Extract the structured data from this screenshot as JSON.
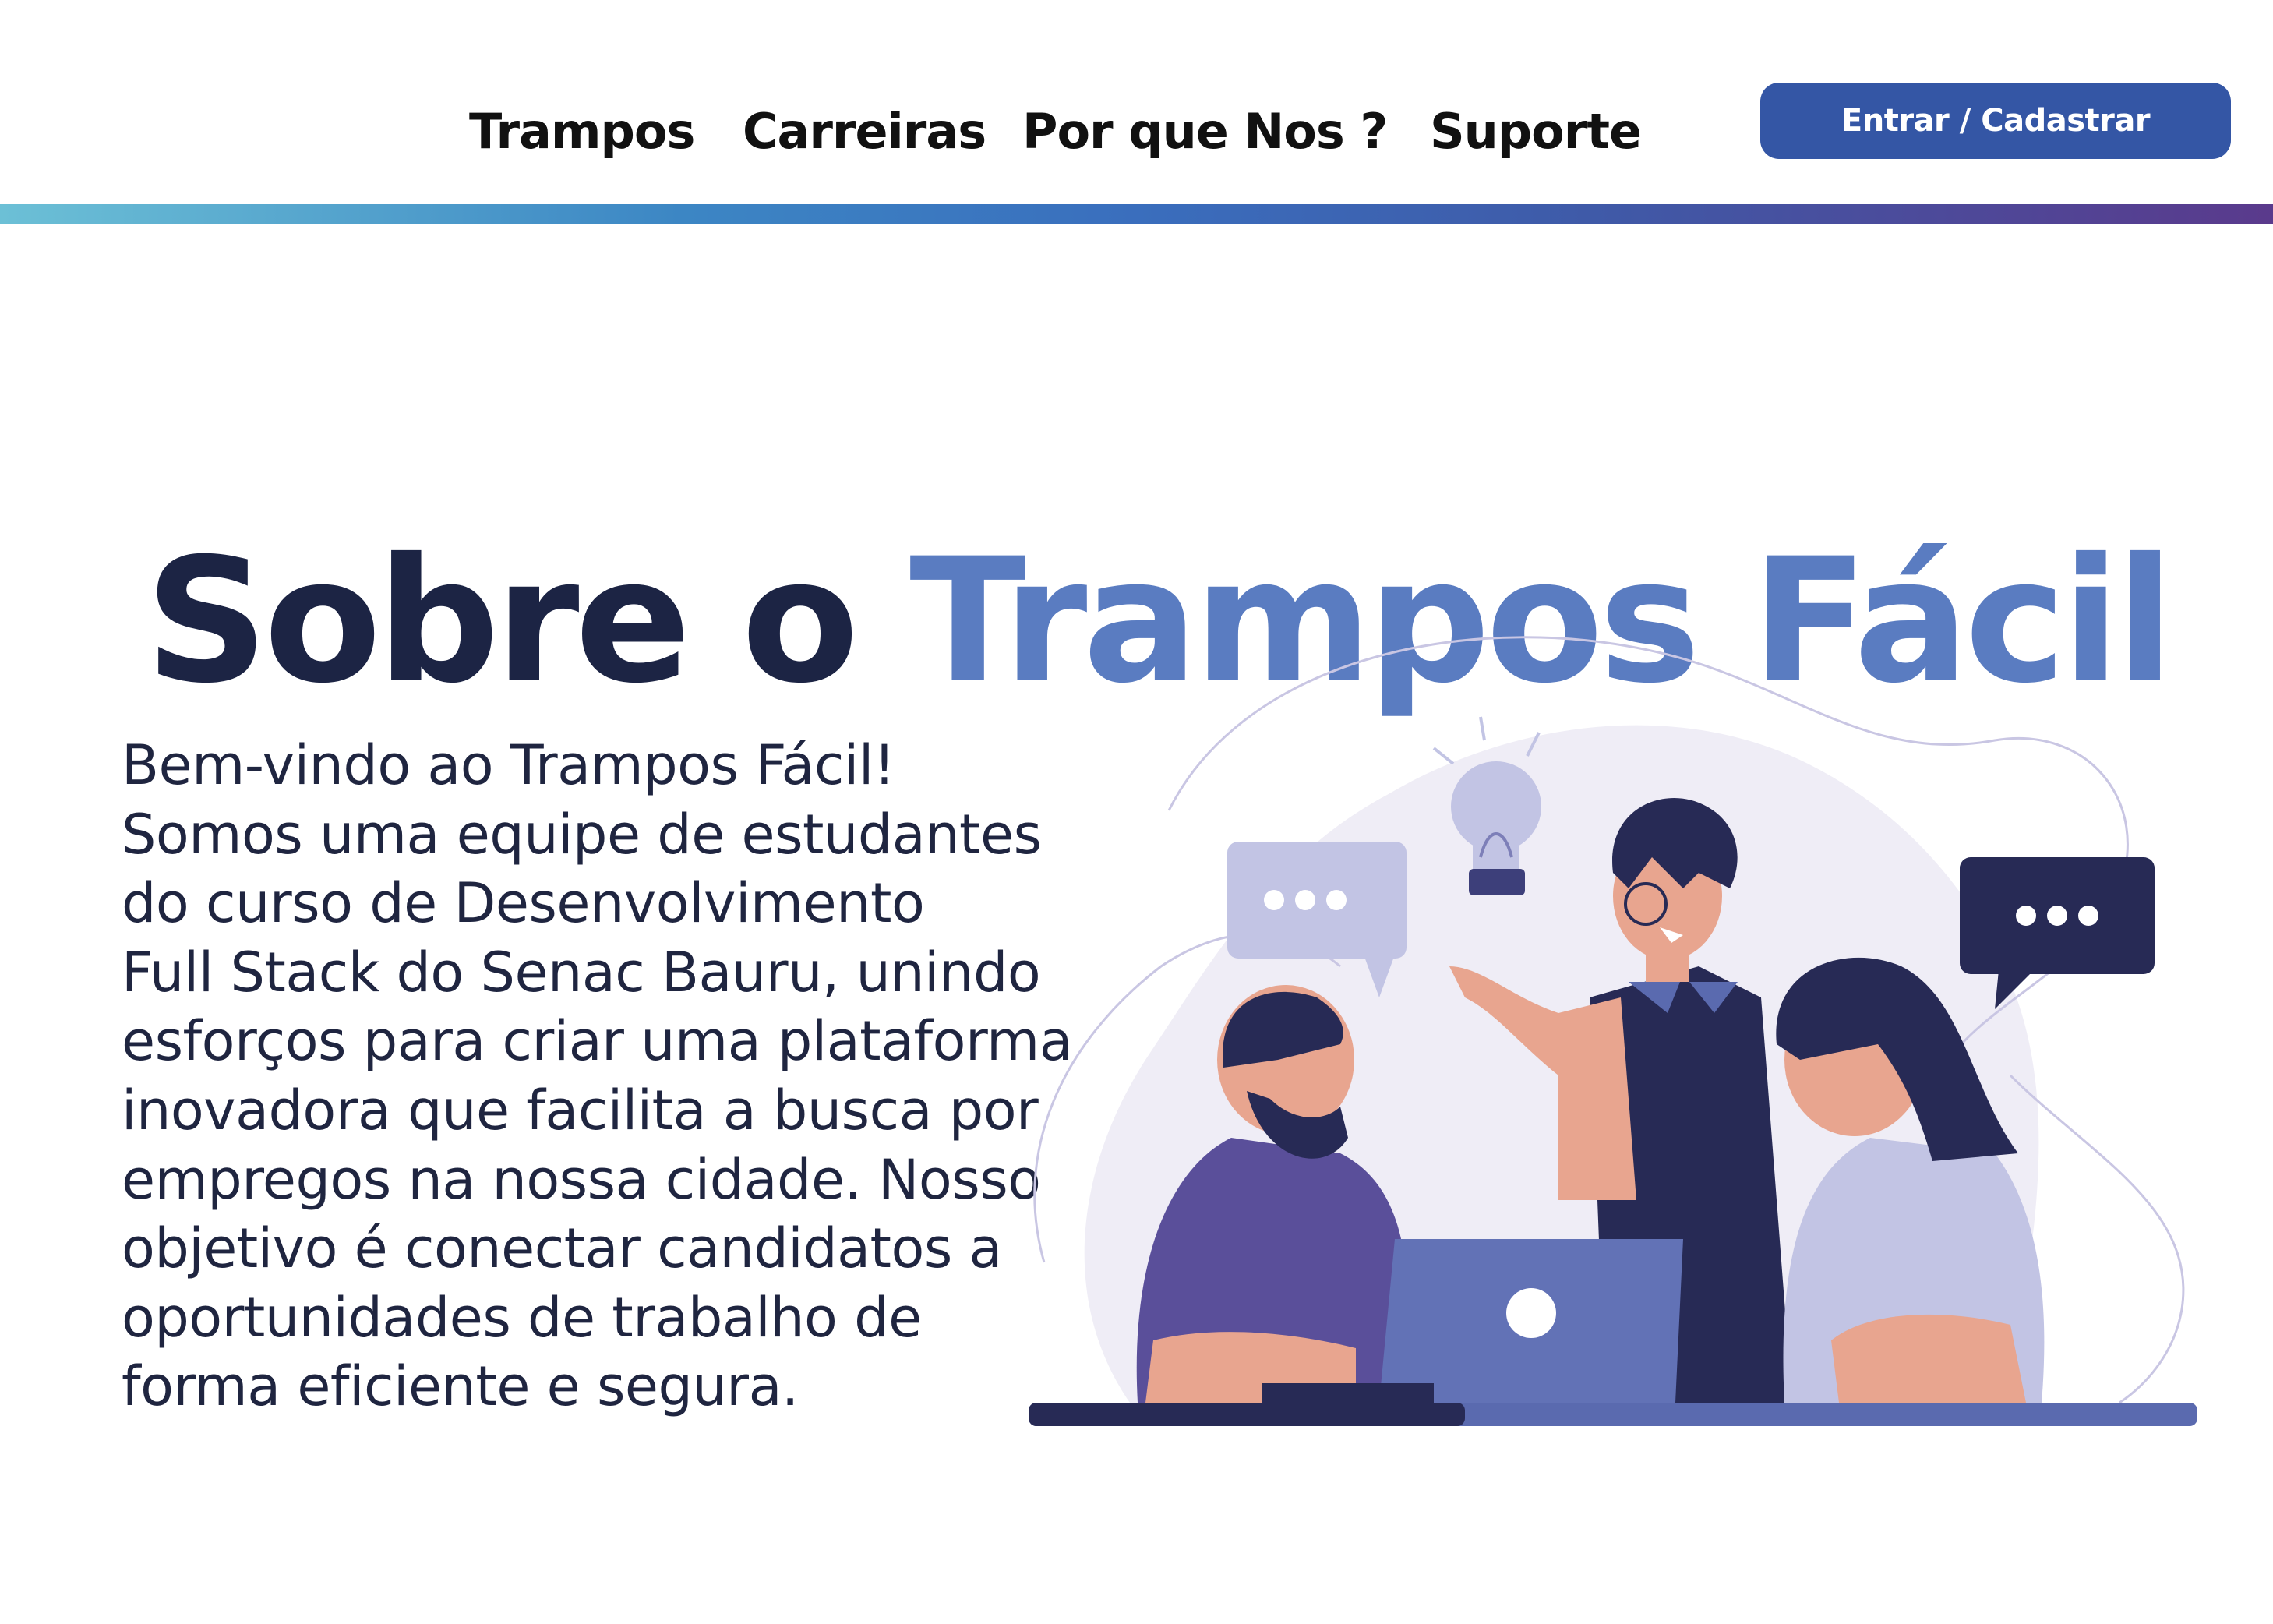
{
  "nav": {
    "links": [
      "Trampos",
      "Carreiras",
      "Por que Nos ?",
      "Suporte"
    ],
    "login_label": "Entrar / Cadastrar"
  },
  "hero": {
    "title_part1": "Sobre o ",
    "title_part2": "Trampos Fácil",
    "paragraph": "Bem-vindo ao Trampos Fácil!\nSomos uma equipe de estudantes\ndo curso de Desenvolvimento\nFull Stack do Senac Bauru, unindo\nesforços para criar uma plataforma\ninovadora que facilita a busca por\nempregos na nossa cidade. Nosso\nobjetivo é conectar candidatos a\noportunidades de trabalho de\nforma eficiente e segura."
  },
  "colors": {
    "dark_navy": "#1c2444",
    "accent_blue": "#5a7cc1",
    "button_blue": "#3456a5"
  }
}
